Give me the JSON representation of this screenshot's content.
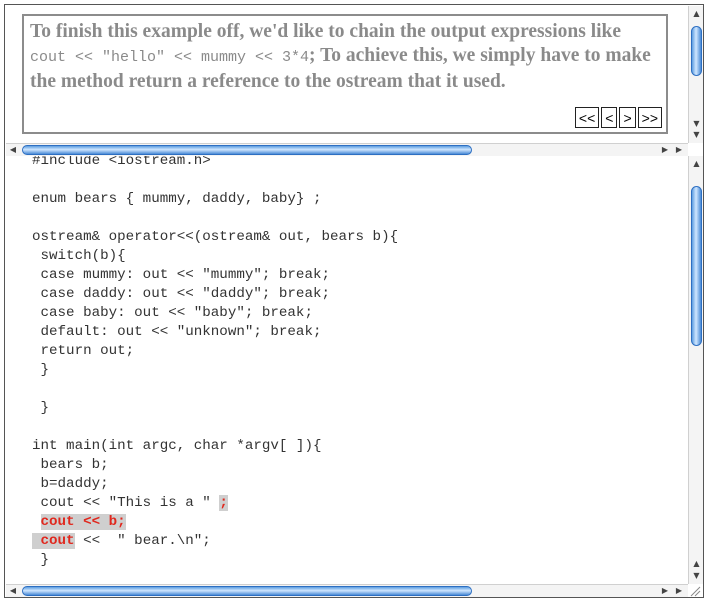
{
  "description": {
    "before_code1": "To finish this example off, we'd like to chain the output expressions like ",
    "code1": "cout << \"hello\" << mummy << 3*4",
    "after_code1": "; To achieve this, we simply have to make the method return a reference to the ostream that it used."
  },
  "nav": {
    "first": "<<",
    "prev": "<",
    "next": ">",
    "last": ">>"
  },
  "code_lines": [
    "#include <iostream.h>",
    "",
    "enum bears { mummy, daddy, baby} ;",
    "",
    "ostream& operator<<(ostream& out, bears b){",
    " switch(b){",
    " case mummy: out << \"mummy\"; break;",
    " case daddy: out << \"daddy\"; break;",
    " case baby: out << \"baby\"; break;",
    " default: out << \"unknown\"; break;",
    " return out;",
    " }",
    "",
    " }",
    "",
    "int main(int argc, char *argv[ ]){",
    " bears b;",
    " b=daddy;",
    " cout << \"This is a \" "
  ],
  "highlighted": {
    "semicolon": ";",
    "line_cout_b": "cout << b;",
    "line_cout_bear_kw": "cout",
    "line_cout_bear_rest": " <<  \" bear.\\n\";",
    "closing": " }"
  }
}
